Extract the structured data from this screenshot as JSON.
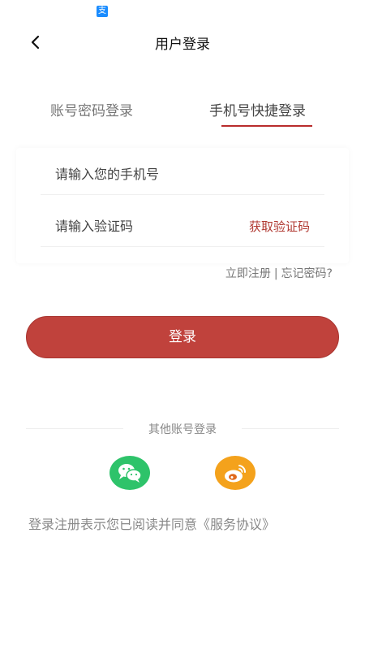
{
  "status_bar": {
    "app_icon": "app-notification-icon"
  },
  "nav": {
    "back_icon": "chevron-left-icon",
    "title": "用户登录"
  },
  "tabs": [
    {
      "label": "账号密码登录",
      "active": false
    },
    {
      "label": "手机号快捷登录",
      "active": true
    }
  ],
  "form": {
    "phone_placeholder": "请输入您的手机号",
    "code_placeholder": "请输入验证码",
    "get_code_label": "获取验证码"
  },
  "links": {
    "register": "立即注册",
    "separator": "|",
    "forgot": "忘记密码?"
  },
  "login_button": "登录",
  "other_login": {
    "label": "其他账号登录",
    "wechat_icon": "wechat-icon",
    "weibo_icon": "weibo-icon"
  },
  "agreement": {
    "text": "登录注册表示您已阅读并同意",
    "link": "《服务协议》"
  },
  "colors": {
    "accent": "#c0423c",
    "tab_underline": "#b92d2d",
    "wechat": "#2ec36a",
    "weibo": "#f4a21c"
  }
}
